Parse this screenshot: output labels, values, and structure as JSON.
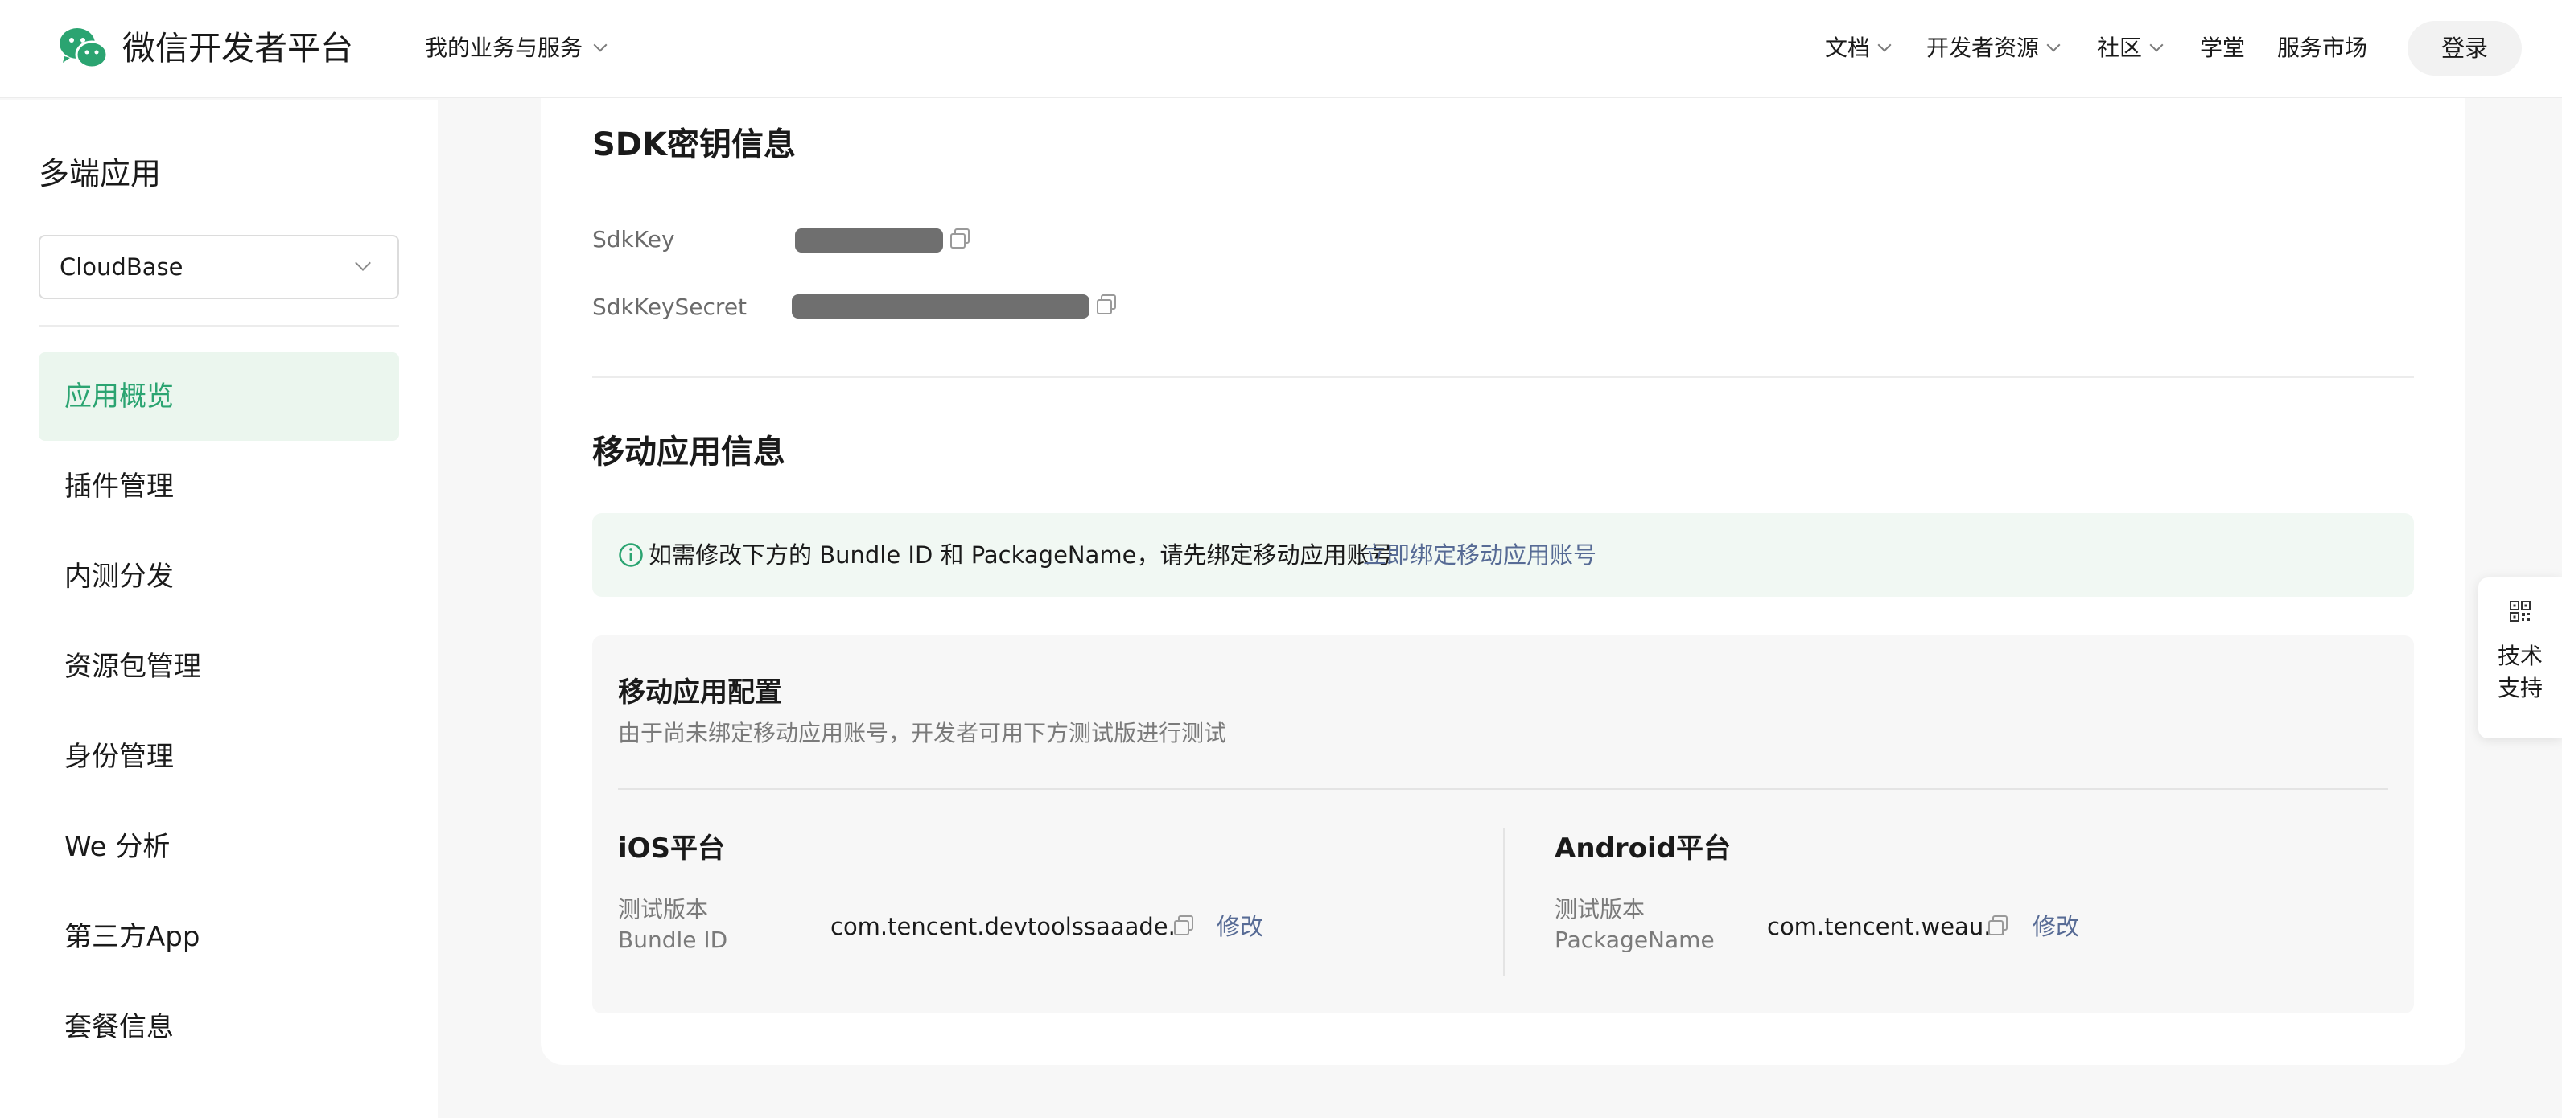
{
  "header": {
    "brand": "微信开发者平台",
    "business_menu": "我的业务与服务",
    "nav": {
      "docs": "文档",
      "resources": "开发者资源",
      "community": "社区",
      "academy": "学堂",
      "market": "服务市场"
    },
    "login": "登录"
  },
  "sidebar": {
    "title": "多端应用",
    "select_value": "CloudBase",
    "items": [
      {
        "label": "应用概览",
        "active": true
      },
      {
        "label": "插件管理"
      },
      {
        "label": "内测分发"
      },
      {
        "label": "资源包管理"
      },
      {
        "label": "身份管理"
      },
      {
        "label": "We 分析"
      },
      {
        "label": "第三方App"
      },
      {
        "label": "套餐信息"
      }
    ]
  },
  "sdk": {
    "title": "SDK密钥信息",
    "key_label": "SdkKey",
    "secret_label": "SdkKeySecret"
  },
  "mobile": {
    "title": "移动应用信息",
    "notice_text": "如需修改下方的 Bundle ID 和 PackageName，请先绑定移动应用账号",
    "notice_link": "立即绑定移动应用账号",
    "config_title": "移动应用配置",
    "config_subtitle": "由于尚未绑定移动应用账号，开发者可用下方测试版进行测试",
    "ios": {
      "title": "iOS平台",
      "label_line1": "测试版本",
      "label_line2": "Bundle ID",
      "value": "com.tencent.devtoolssaaade...",
      "edit": "修改"
    },
    "android": {
      "title": "Android平台",
      "label_line1": "测试版本",
      "label_line2": "PackageName",
      "value": "com.tencent.weau...",
      "edit": "修改"
    }
  },
  "support": {
    "line1": "技术",
    "line2": "支持"
  },
  "colors": {
    "accent_green": "#2ba471",
    "link_blue": "#576b95",
    "active_bg": "#ebf6ee"
  }
}
